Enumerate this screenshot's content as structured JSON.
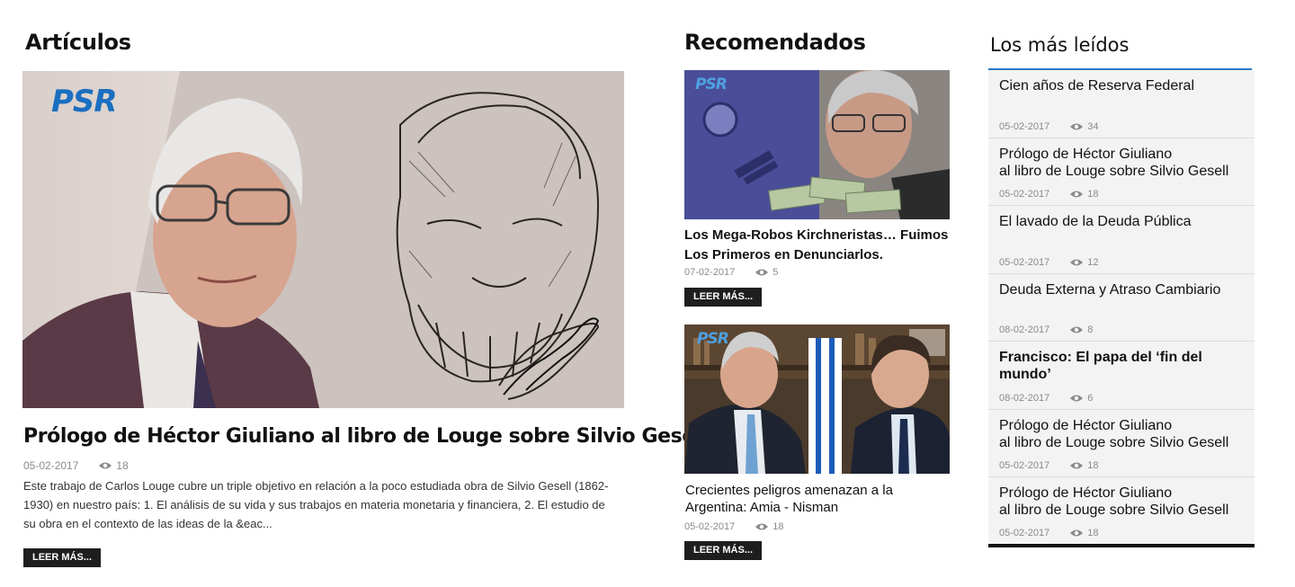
{
  "articles": {
    "heading": "Artículos",
    "main": {
      "title": "Prólogo de Héctor Giuliano al libro de Louge sobre Silvio Gesell",
      "date": "05-02-2017",
      "views": "18",
      "excerpt": "Este trabajo de Carlos Louge cubre un triple objetivo en relación a la poco estudiada obra de Silvio Gesell (1862-1930) en nuestro país: 1. El análisis de su vida y sus trabajos en materia monetaria y financiera, 2. El estudio de su obra en el contexto de las ideas de la &eac...",
      "button": "LEER MÁS...",
      "logo": "PSR"
    }
  },
  "recommended": {
    "heading": "Recomendados",
    "items": [
      {
        "title": "Los Mega-Robos Kirchneristas… Fuimos Los Primeros en Denunciarlos.",
        "date": "07-02-2017",
        "views": "5",
        "button": "LEER MÁS...",
        "logo": "PSR"
      },
      {
        "title": "Crecientes peligros amenazan a la Argentina: Amia - Nisman",
        "date": "05-02-2017",
        "views": "18",
        "button": "LEER MÁS...",
        "logo": "PSR"
      }
    ]
  },
  "most_read": {
    "heading": "Los más leídos",
    "accent": "#2a7bc4",
    "items": [
      {
        "title": "Cien años de Reserva Federal",
        "date": "05-02-2017",
        "views": "34"
      },
      {
        "title": "Prólogo de Héctor Giuliano\nal libro de Louge sobre Silvio Gesell",
        "date": "05-02-2017",
        "views": "18"
      },
      {
        "title": "El lavado de la Deuda Pública",
        "date": "05-02-2017",
        "views": "12"
      },
      {
        "title": "Deuda Externa y Atraso Cambiario",
        "date": "08-02-2017",
        "views": "8"
      },
      {
        "title": "Francisco: El papa del ‘fin del mundo’",
        "date": "08-02-2017",
        "views": "6"
      },
      {
        "title": "Prólogo de Héctor Giuliano\nal libro de Louge sobre Silvio Gesell",
        "date": "05-02-2017",
        "views": "18"
      },
      {
        "title": "Prólogo de Héctor Giuliano\nal libro de Louge sobre Silvio Gesell",
        "date": "05-02-2017",
        "views": "18"
      }
    ]
  }
}
